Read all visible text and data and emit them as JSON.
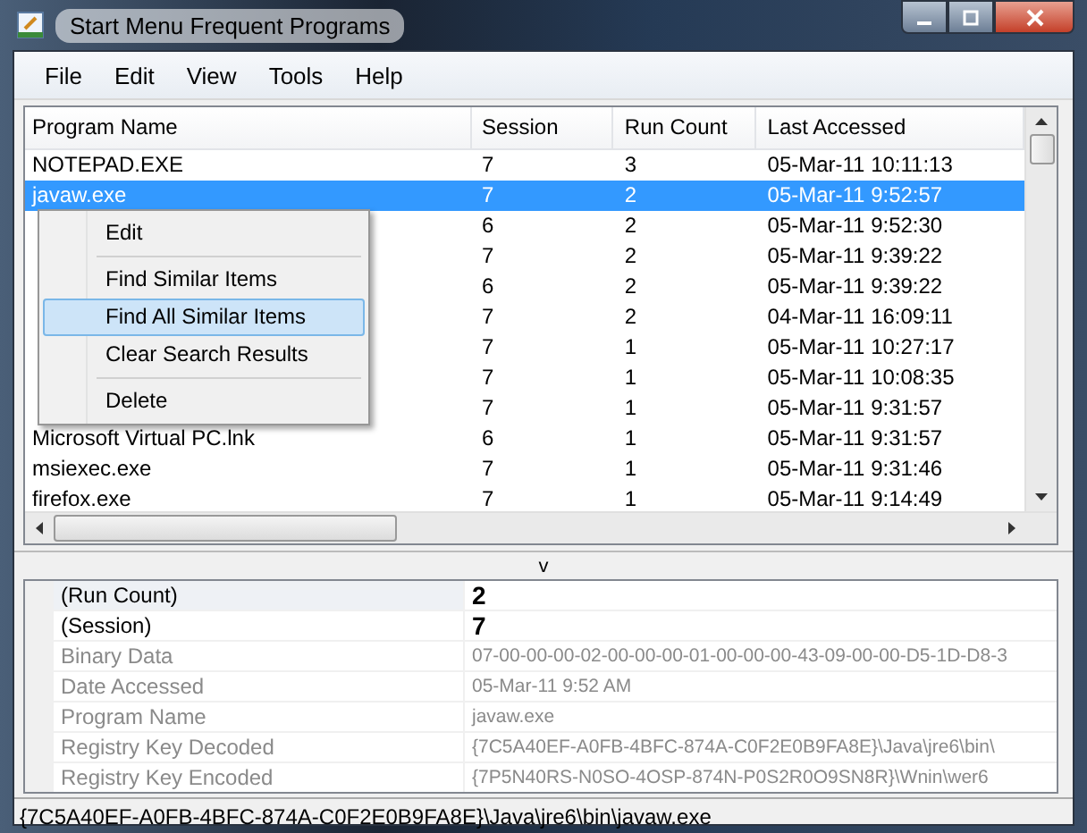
{
  "window": {
    "title": "Start Menu Frequent Programs"
  },
  "menu_bar": [
    "File",
    "Edit",
    "View",
    "Tools",
    "Help"
  ],
  "table": {
    "columns": [
      "Program Name",
      "Session",
      "Run Count",
      "Last Accessed"
    ],
    "rows": [
      {
        "program_name": "NOTEPAD.EXE",
        "session": "7",
        "run_count": "3",
        "last_accessed": "05-Mar-11 10:11:13",
        "selected": false
      },
      {
        "program_name": "javaw.exe",
        "session": "7",
        "run_count": "2",
        "last_accessed": "05-Mar-11 9:52:57",
        "selected": true
      },
      {
        "session": "6",
        "run_count": "2",
        "last_accessed": "05-Mar-11 9:52:30",
        "selected": false
      },
      {
        "session": "7",
        "run_count": "2",
        "last_accessed": "05-Mar-11 9:39:22",
        "selected": false
      },
      {
        "session": "6",
        "run_count": "2",
        "last_accessed": "05-Mar-11 9:39:22",
        "selected": false
      },
      {
        "session": "7",
        "run_count": "2",
        "last_accessed": "04-Mar-11 16:09:11",
        "selected": false
      },
      {
        "session": "7",
        "run_count": "1",
        "last_accessed": "05-Mar-11 10:27:17",
        "selected": false
      },
      {
        "session": "7",
        "run_count": "1",
        "last_accessed": "05-Mar-11 10:08:35",
        "selected": false
      },
      {
        "session": "7",
        "run_count": "1",
        "last_accessed": "05-Mar-11 9:31:57",
        "selected": false
      },
      {
        "program_name": "Microsoft Virtual PC.lnk",
        "session": "6",
        "run_count": "1",
        "last_accessed": "05-Mar-11 9:31:57",
        "selected": false
      },
      {
        "program_name": "msiexec.exe",
        "session": "7",
        "run_count": "1",
        "last_accessed": "05-Mar-11 9:31:46",
        "selected": false
      },
      {
        "program_name": "firefox.exe",
        "session": "7",
        "run_count": "1",
        "last_accessed": "05-Mar-11 9:14:49",
        "selected": false
      }
    ]
  },
  "context_menu": [
    {
      "kind": "item",
      "label": "Edit",
      "selected": false
    },
    {
      "kind": "separator"
    },
    {
      "kind": "item",
      "label": "Find Similar Items",
      "selected": false
    },
    {
      "kind": "item",
      "label": "Find All Similar Items",
      "selected": true
    },
    {
      "kind": "item",
      "label": "Clear Search Results",
      "selected": false
    },
    {
      "kind": "separator"
    },
    {
      "kind": "item",
      "label": "Delete",
      "selected": false
    }
  ],
  "splitter": {
    "label": "v"
  },
  "properties": [
    {
      "name": "(Run Count)",
      "value": "2",
      "emphasized": true,
      "selected": true
    },
    {
      "name": "(Session)",
      "value": "7",
      "emphasized": true,
      "selected": false
    },
    {
      "name": "Binary Data",
      "value": "07-00-00-00-02-00-00-00-01-00-00-00-43-09-00-00-D5-1D-D8-3",
      "emphasized": false,
      "selected": false
    },
    {
      "name": "Date Accessed",
      "value": "05-Mar-11 9:52 AM",
      "emphasized": false,
      "selected": false
    },
    {
      "name": "Program Name",
      "value": "javaw.exe",
      "emphasized": false,
      "selected": false
    },
    {
      "name": "Registry Key Decoded",
      "value": "{7C5A40EF-A0FB-4BFC-874A-C0F2E0B9FA8E}\\Java\\jre6\\bin\\",
      "emphasized": false,
      "selected": false
    },
    {
      "name": "Registry Key Encoded",
      "value": "{7P5N40RS-N0SO-4OSP-874N-P0S2R0O9SN8R}\\Wnin\\wer6",
      "emphasized": false,
      "selected": false
    }
  ],
  "status_bar": "{7C5A40EF-A0FB-4BFC-874A-C0F2E0B9FA8E}\\Java\\jre6\\bin\\javaw.exe"
}
